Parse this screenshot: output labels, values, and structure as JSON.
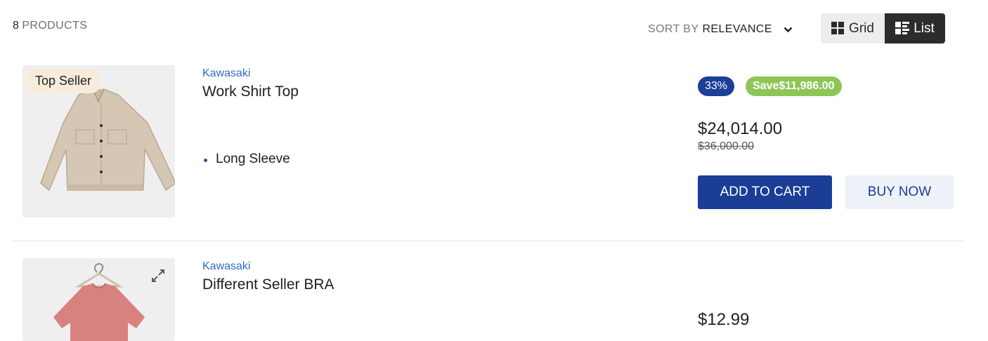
{
  "header": {
    "count_number": "8",
    "count_label": "PRODUCTS",
    "sort_label": "SORT BY",
    "sort_value": "RELEVANCE",
    "view_grid_label": "Grid",
    "view_list_label": "List"
  },
  "products": [
    {
      "brand": "Kawasaki",
      "name": "Work Shirt Top",
      "badge": "Top Seller",
      "features": [
        "Long Sleeve"
      ],
      "discount_percent": "33%",
      "savings": "Save$11,986.00",
      "price": "$24,014.00",
      "original_price": "$36,000.00",
      "add_to_cart_label": "ADD TO CART",
      "buy_now_label": "BUY NOW",
      "image_icon": "shirt-image"
    },
    {
      "brand": "Kawasaki",
      "name": "Different Seller BRA",
      "price": "$12.99",
      "image_icon": "tshirt-on-hanger-image"
    }
  ],
  "colors": {
    "accent": "#1b3d96",
    "brand_link": "#2f6bd2",
    "save_badge": "#8dc657",
    "top_seller_badge": "#f7ecdb"
  }
}
